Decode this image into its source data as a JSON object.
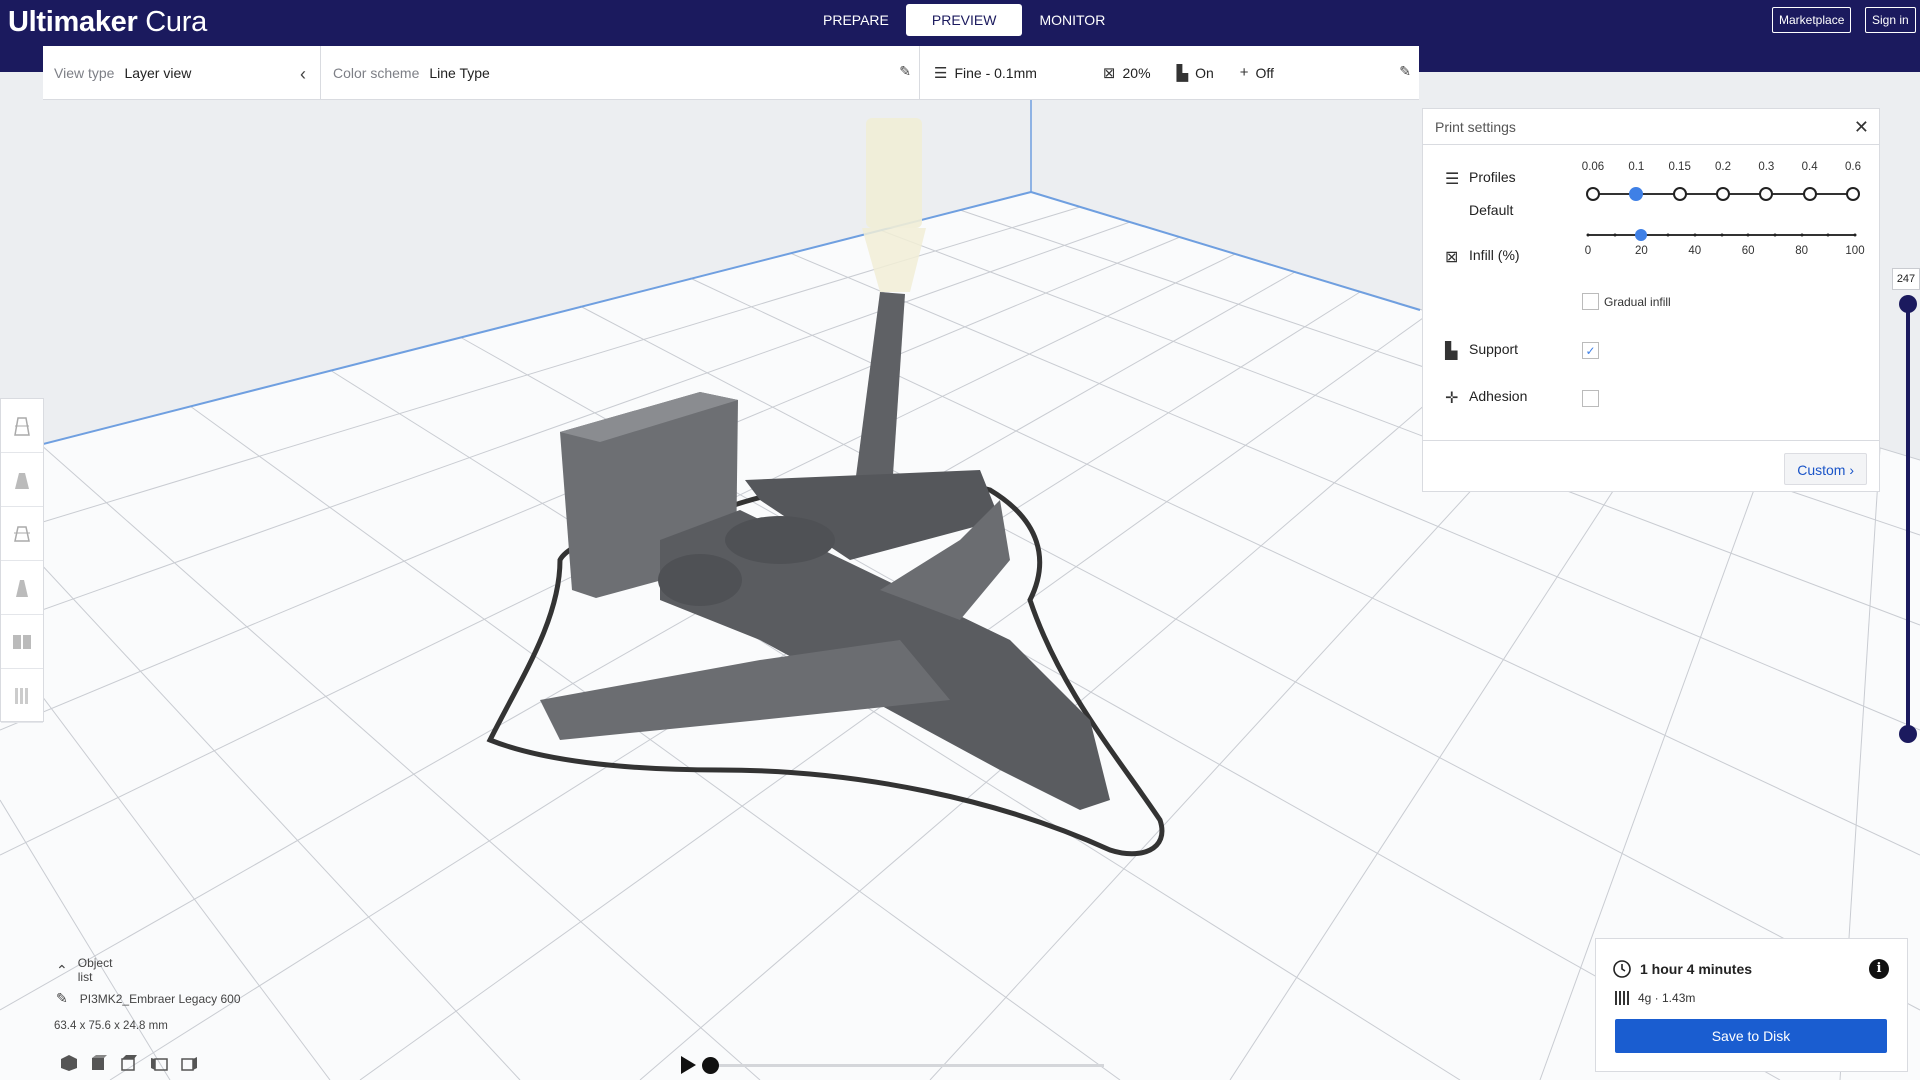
{
  "app": {
    "title_bold": "Ultimaker",
    "title_rest": " Cura"
  },
  "stages": [
    {
      "label": "PREPARE",
      "active": false
    },
    {
      "label": "PREVIEW",
      "active": true
    },
    {
      "label": "MONITOR",
      "active": false
    }
  ],
  "top_buttons": {
    "marketplace": "Marketplace",
    "sign_in": "Sign in"
  },
  "view": {
    "type_label": "View type",
    "type_value": "Layer view",
    "scheme_label": "Color scheme",
    "scheme_value": "Line Type"
  },
  "print_summary": {
    "profile": "Fine - 0.1mm",
    "infill": "20%",
    "support": "On",
    "adhesion": "Off"
  },
  "print_settings": {
    "title": "Print settings",
    "profiles_label": "Profiles",
    "profile_name": "Default",
    "layer_heights": [
      "0.06",
      "0.1",
      "0.15",
      "0.2",
      "0.3",
      "0.4",
      "0.6"
    ],
    "selected_layer_height": "0.1",
    "infill_label": "Infill (%)",
    "infill_ticks": [
      "0",
      "20",
      "40",
      "60",
      "80",
      "100"
    ],
    "infill_value": 20,
    "gradual_infill_label": "Gradual infill",
    "gradual_infill": false,
    "support_label": "Support",
    "support": true,
    "adhesion_label": "Adhesion",
    "adhesion": false,
    "custom_label": "Custom"
  },
  "layer_view": {
    "current_layer": "247"
  },
  "object_list": {
    "toggle_label": "Object list",
    "file_name": "PI3MK2_Embraer Legacy 600",
    "dimensions": "63.4 x 75.6 x 24.8 mm"
  },
  "output": {
    "print_time": "1 hour 4 minutes",
    "material": "4g · 1.43m",
    "save_label": "Save to Disk"
  },
  "colors": {
    "header": "#1b1a5e",
    "accent": "#3f80e6",
    "save_button": "#1a5dd0"
  }
}
